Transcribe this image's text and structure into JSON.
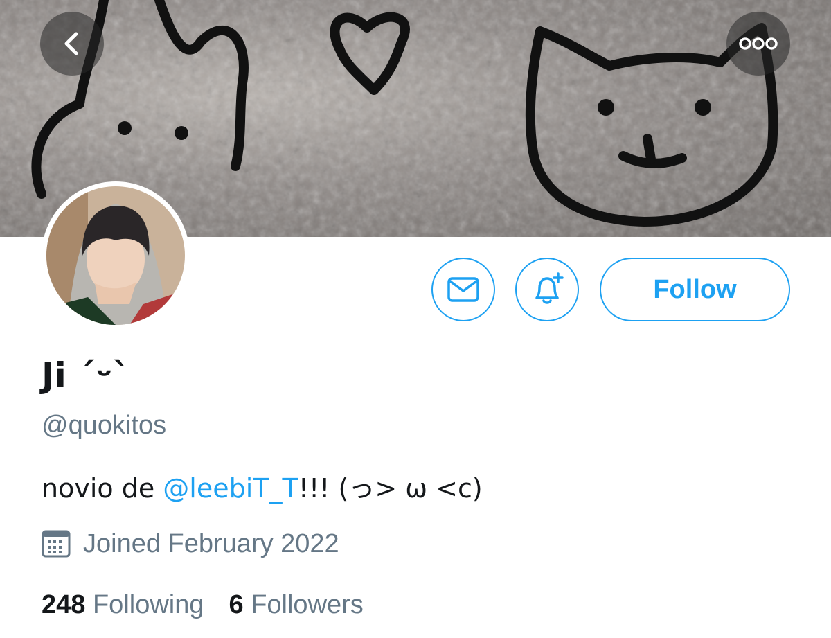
{
  "header": {
    "back_icon": "chevron-left-icon",
    "more_icon": "more-horizontal-icon"
  },
  "actions": {
    "message_icon": "envelope-icon",
    "notify_icon": "bell-plus-icon",
    "follow_label": "Follow"
  },
  "profile": {
    "display_name": "Ji ´ᵕ`",
    "handle": "@quokitos",
    "bio_prefix": "novio de ",
    "bio_mention": "@leebiT_T",
    "bio_suffix": "!!! (っ> ω <c)",
    "joined_icon": "calendar-icon",
    "joined": "Joined February 2022"
  },
  "stats": {
    "following_count": "248",
    "following_label": "Following",
    "followers_count": "6",
    "followers_label": "Followers"
  },
  "colors": {
    "accent": "#1da1f2",
    "text_primary": "#14171a",
    "text_secondary": "#657786"
  }
}
